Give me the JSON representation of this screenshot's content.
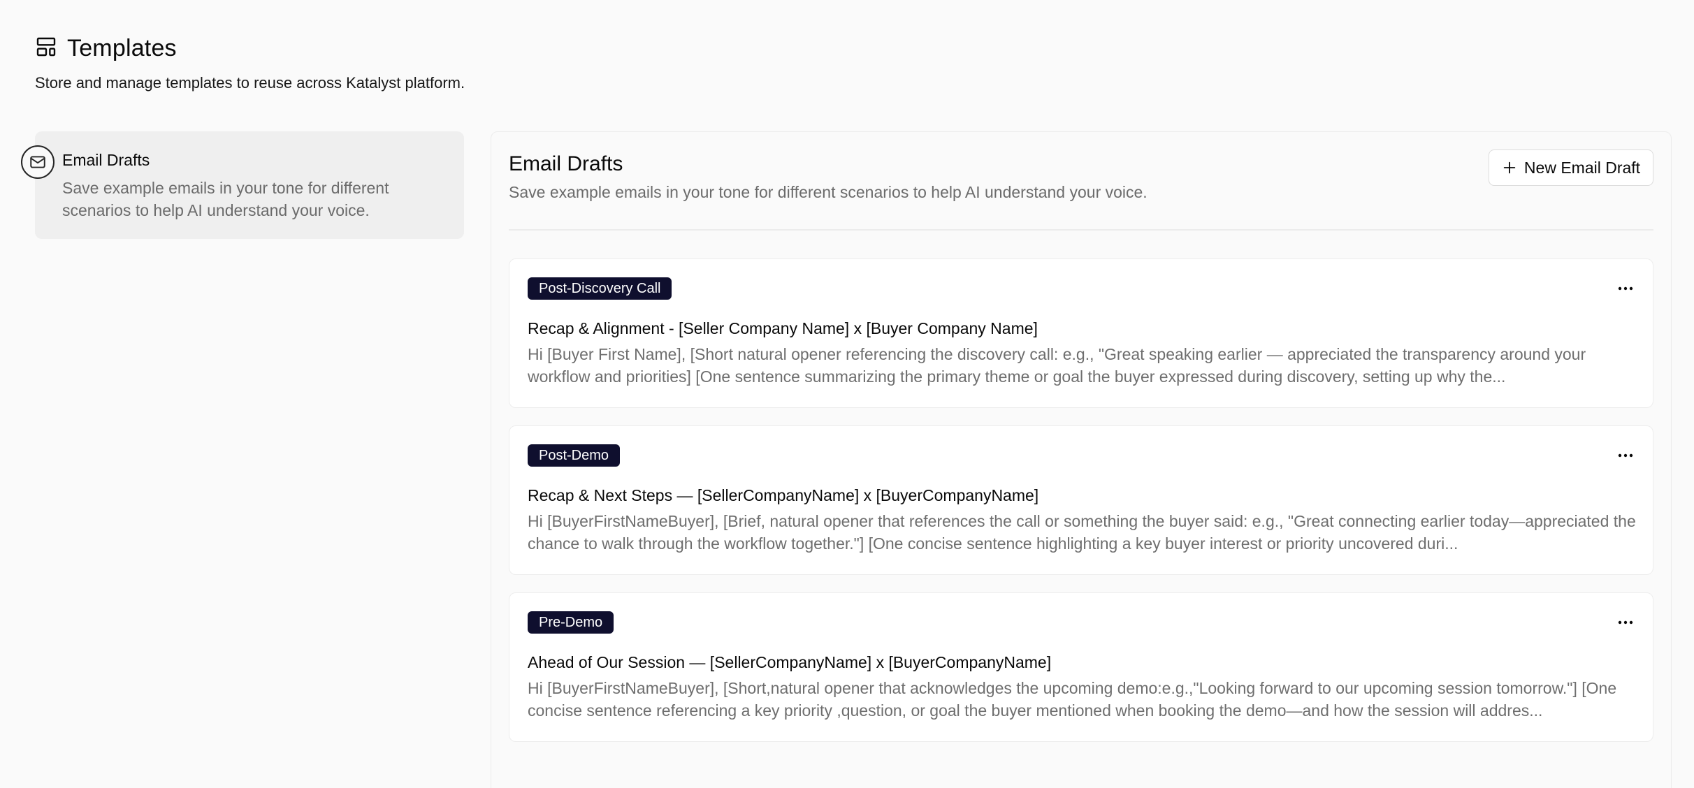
{
  "header": {
    "title": "Templates",
    "icon": "layout-template-icon",
    "subtitle": "Store and manage templates to reuse across Katalyst platform."
  },
  "sidebar": {
    "items": [
      {
        "icon": "mail-icon",
        "label": "Email Drafts",
        "description": "Save example emails in your tone for different scenarios to help AI understand your voice.",
        "selected": true
      }
    ]
  },
  "main": {
    "title": "Email Drafts",
    "description": "Save example emails in your tone for different scenarios to help AI understand your voice.",
    "new_button_label": "New Email Draft",
    "drafts": [
      {
        "tag": "Post-Discovery Call",
        "subject": "Recap & Alignment - [Seller Company Name] x [Buyer Company Name]",
        "preview": "Hi [Buyer First Name], [Short natural opener referencing the discovery call: e.g., \"Great speaking earlier — appreciated the transparency around your workflow and priorities] [One sentence summarizing the primary theme or goal the buyer expressed during discovery, setting up why the..."
      },
      {
        "tag": "Post-Demo",
        "subject": "Recap & Next Steps — [SellerCompanyName] x [BuyerCompanyName]",
        "preview": "Hi [BuyerFirstNameBuyer], [Brief, natural opener that references the call or something the buyer said: e.g., \"Great connecting earlier today—appreciated the chance to walk through the workflow together.\"] [One concise sentence highlighting a key buyer interest or priority uncovered duri..."
      },
      {
        "tag": "Pre-Demo",
        "subject": "Ahead of Our Session — [SellerCompanyName] x [BuyerCompanyName]",
        "preview": "Hi [BuyerFirstNameBuyer], [Short,natural opener that acknowledges the upcoming demo:e.g.,\"Looking forward to our upcoming session tomorrow.\"] [One concise sentence referencing a key priority ,question, or goal the buyer mentioned when booking the demo—and how the session will addres..."
      }
    ]
  },
  "colors": {
    "background": "#fafafa",
    "badge": "#0f0f2e",
    "selected_item": "#efefef",
    "muted_text": "#6e6e6e"
  }
}
